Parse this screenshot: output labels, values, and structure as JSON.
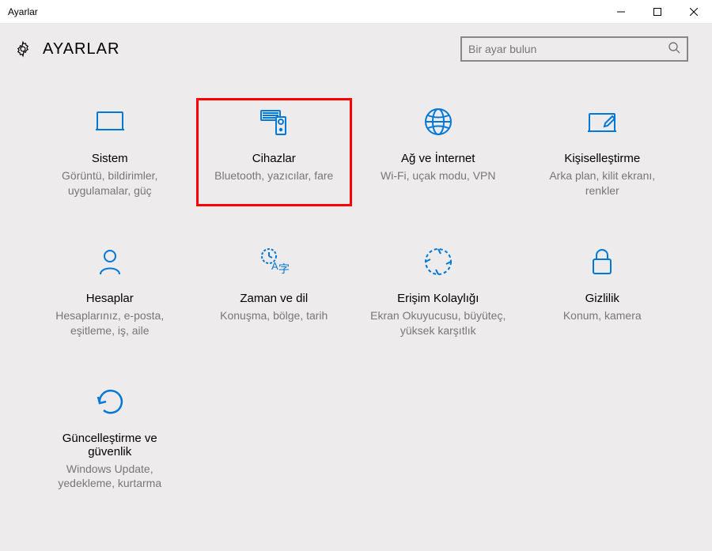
{
  "window": {
    "title": "Ayarlar"
  },
  "header": {
    "title": "AYARLAR"
  },
  "search": {
    "placeholder": "Bir ayar bulun"
  },
  "tiles": {
    "system": {
      "title": "Sistem",
      "desc": "Görüntü, bildirimler, uygulamalar, güç"
    },
    "devices": {
      "title": "Cihazlar",
      "desc": "Bluetooth, yazıcılar, fare"
    },
    "network": {
      "title": "Ağ ve İnternet",
      "desc": "Wi-Fi, uçak modu, VPN"
    },
    "personalization": {
      "title": "Kişiselleştirme",
      "desc": "Arka plan, kilit ekranı, renkler"
    },
    "accounts": {
      "title": "Hesaplar",
      "desc": "Hesaplarınız, e-posta, eşitleme, iş, aile"
    },
    "time": {
      "title": "Zaman ve dil",
      "desc": "Konuşma, bölge, tarih"
    },
    "ease": {
      "title": "Erişim Kolaylığı",
      "desc": "Ekran Okuyucusu, büyüteç, yüksek karşıtlık"
    },
    "privacy": {
      "title": "Gizlilik",
      "desc": "Konum, kamera"
    },
    "update": {
      "title": "Güncelleştirme ve güvenlik",
      "desc": "Windows Update, yedekleme, kurtarma"
    }
  },
  "colors": {
    "accent": "#0078d7",
    "highlight": "#ff0000"
  }
}
